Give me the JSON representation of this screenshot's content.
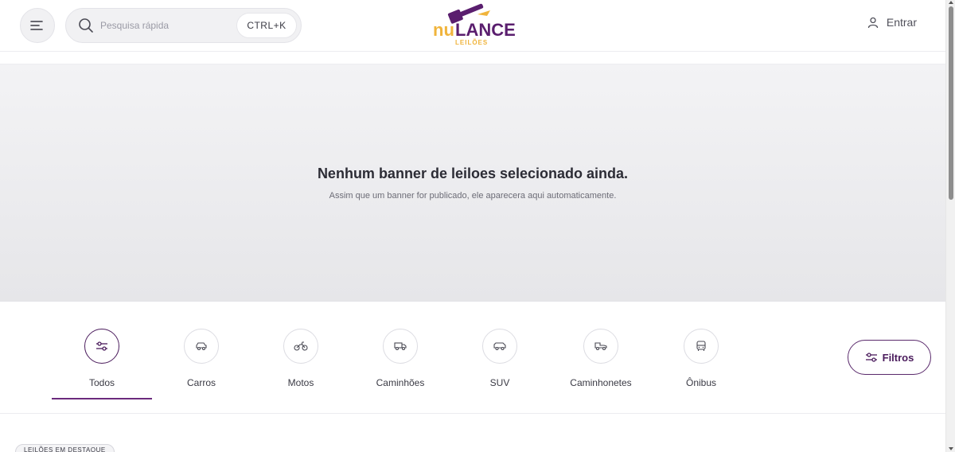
{
  "header": {
    "search_placeholder": "Pesquisa rápida",
    "shortcut": "CTRL+K",
    "login_label": "Entrar",
    "logo": {
      "word_left": "nu",
      "word_right": "LANCE",
      "sub": "LEILÕES"
    }
  },
  "banner": {
    "title": "Nenhum banner de leiloes selecionado ainda.",
    "subtitle": "Assim que um banner for publicado, ele aparecera aqui automaticamente."
  },
  "categories": {
    "items": [
      {
        "label": "Todos",
        "icon": "sliders-icon",
        "active": true
      },
      {
        "label": "Carros",
        "icon": "car-icon"
      },
      {
        "label": "Motos",
        "icon": "motorcycle-icon"
      },
      {
        "label": "Caminhões",
        "icon": "truck-icon"
      },
      {
        "label": "SUV",
        "icon": "suv-icon"
      },
      {
        "label": "Caminhonetes",
        "icon": "pickup-icon"
      },
      {
        "label": "Ônibus",
        "icon": "bus-icon"
      }
    ],
    "filters_label": "Filtros"
  },
  "featured": {
    "chip_label": "LEILÕES EM DESTAQUE"
  },
  "colors": {
    "brand_purple": "#5a1e6e",
    "brand_yellow": "#f0b43c",
    "active_underline": "#6b2a7d"
  }
}
